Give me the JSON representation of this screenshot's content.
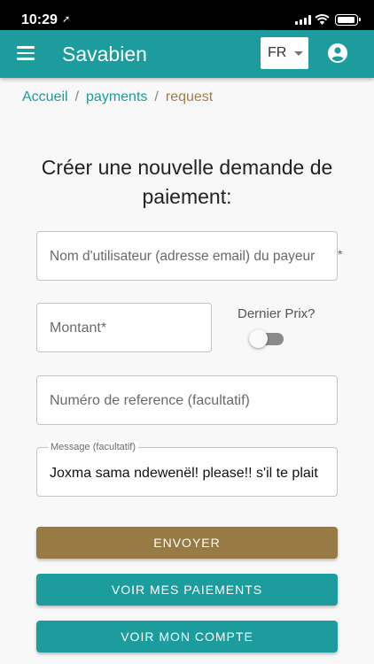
{
  "status_bar": {
    "time": "10:29",
    "location_glyph": "➚"
  },
  "app_bar": {
    "title": "Savabien",
    "language": "FR",
    "menu_icon": "hamburger-menu-icon",
    "account_icon": "account-circle-icon",
    "color": "#1c9c9c"
  },
  "breadcrumb": {
    "items": [
      "Accueil",
      "payments",
      "request"
    ],
    "separator": "/"
  },
  "form": {
    "title": "Créer une nouvelle demande de paiement:",
    "payer_field": {
      "placeholder": "Nom d'utilisateur (adresse email) du payeur",
      "required_mark": "*"
    },
    "amount_field": {
      "placeholder": "Montant*"
    },
    "last_price_toggle": {
      "label": "Dernier Prix?",
      "checked": false
    },
    "reference_field": {
      "placeholder": "Numéro de reference (facultatif)"
    },
    "message_field": {
      "label": "Message (facultatif)",
      "value": "Joxma sama ndewenël! please!! s'il te plait"
    }
  },
  "buttons": {
    "send": "ENVOYER",
    "my_payments": "VOIR MES PAIEMENTS",
    "my_account": "VOIR MON COMPTE"
  },
  "colors": {
    "primary": "#1c9c9c",
    "accent": "#987a45"
  }
}
